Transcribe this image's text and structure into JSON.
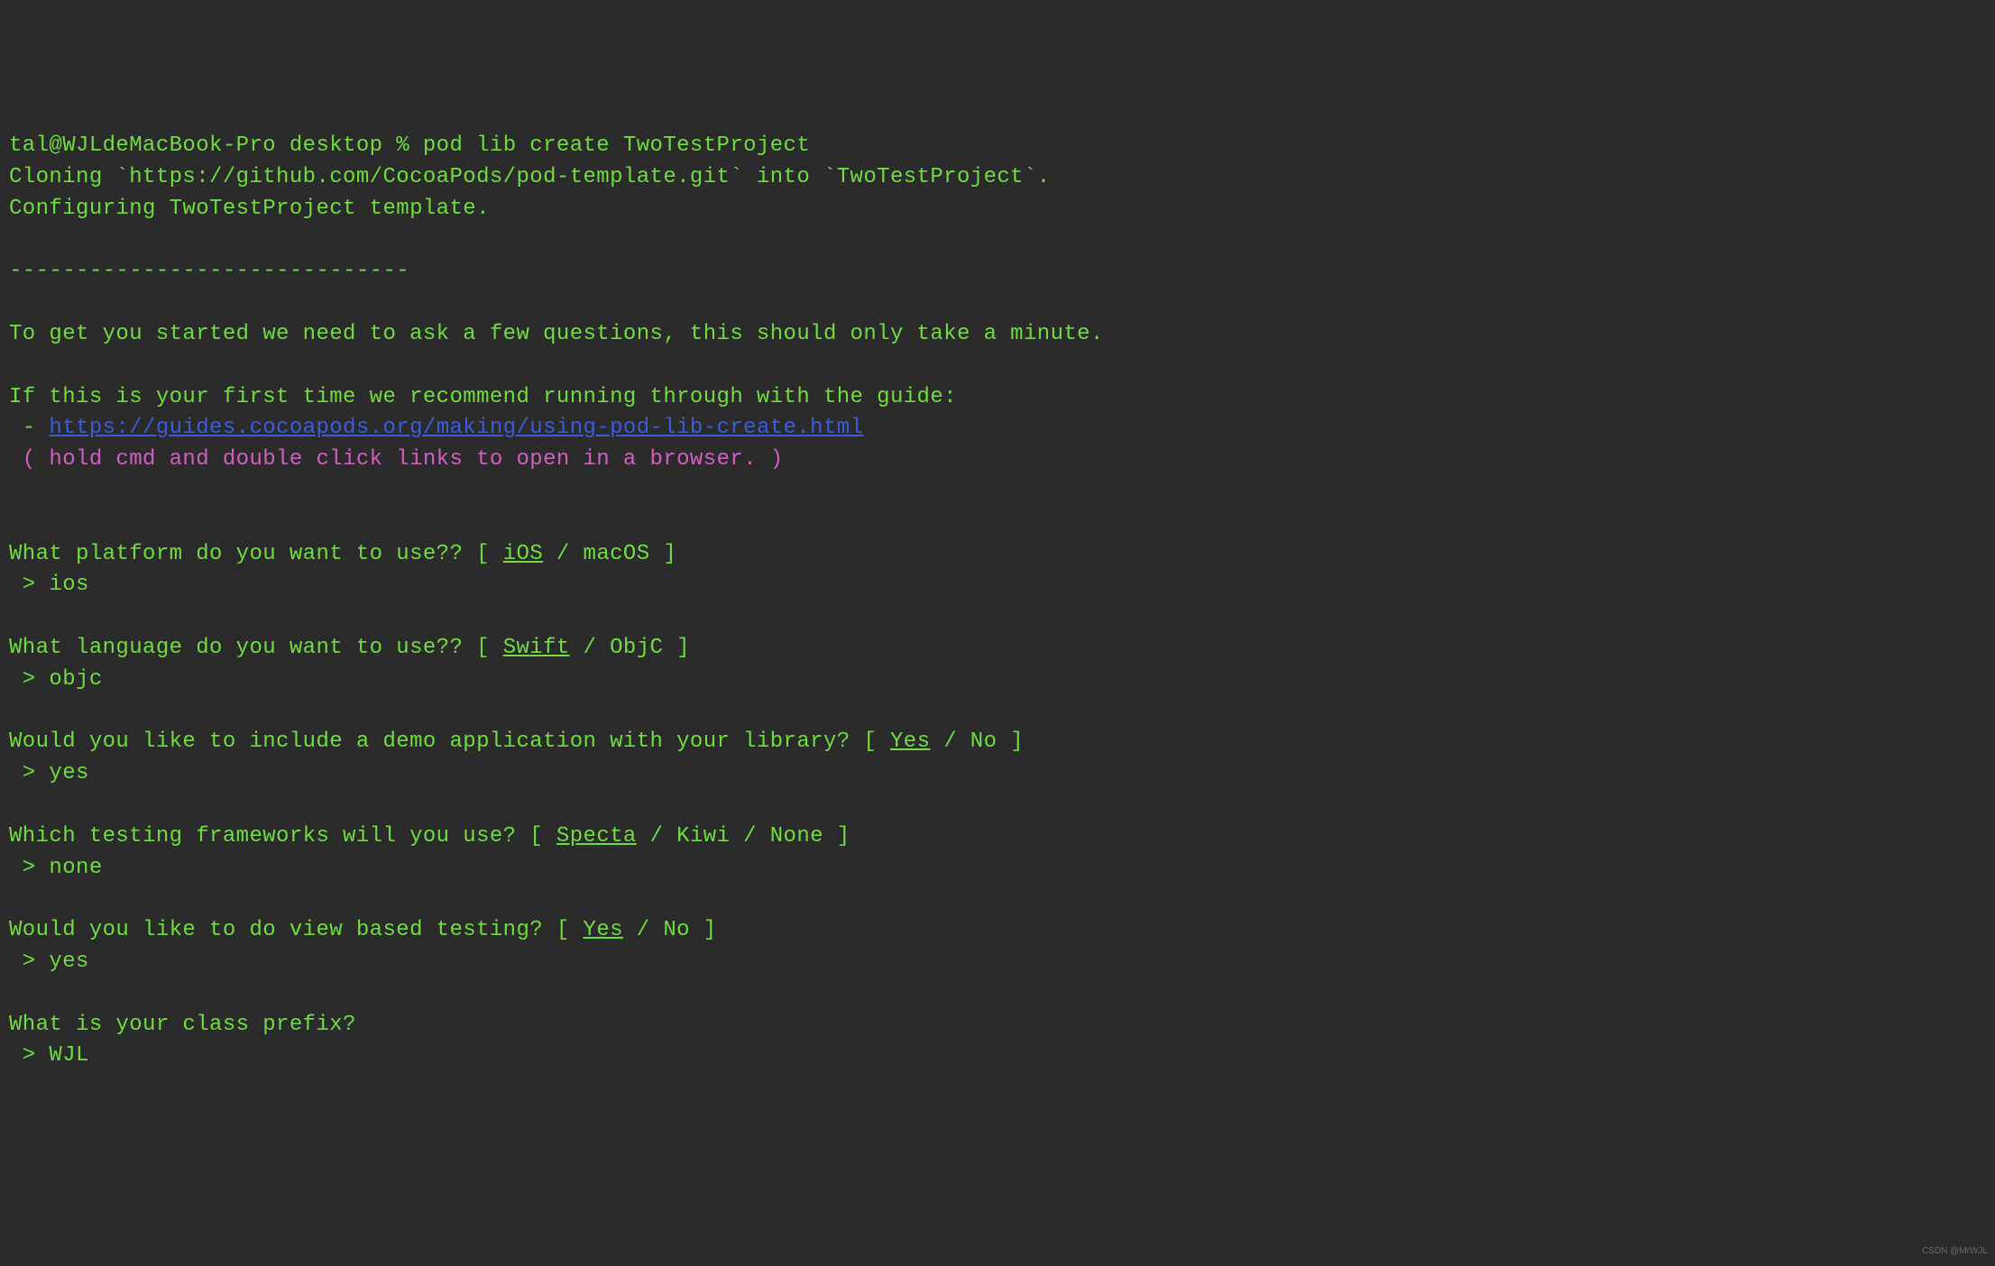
{
  "prompt_user": "tal@WJLdeMacBook-Pro",
  "prompt_dir": " desktop % ",
  "command": "pod lib create TwoTestProject",
  "line_cloning": "Cloning `https://github.com/CocoaPods/pod-template.git` into `TwoTestProject`.",
  "line_configuring": "Configuring TwoTestProject template.",
  "separator": "------------------------------",
  "line_intro1": "To get you started we need to ask a few questions, this should only take a minute.",
  "line_intro2": "If this is your first time we recommend running through with the guide:",
  "guide_bullet": " - ",
  "guide_url": "https://guides.cocoapods.org/making/using-pod-lib-create.html",
  "line_hint": " ( hold cmd and double click links to open in a browser. )",
  "q1_prefix": "What platform do you want to use?? [ ",
  "q1_underlined": "iOS",
  "q1_suffix": " / macOS ]",
  "a1": " > ios",
  "q2_prefix": "What language do you want to use?? [ ",
  "q2_underlined": "Swift",
  "q2_suffix": " / ObjC ]",
  "a2": " > objc",
  "q3_prefix": "Would you like to include a demo application with your library? [ ",
  "q3_underlined": "Yes",
  "q3_suffix": " / No ]",
  "a3": " > yes",
  "q4_prefix": "Which testing frameworks will you use? [ ",
  "q4_underlined": "Specta",
  "q4_suffix": " / Kiwi / None ]",
  "a4": " > none",
  "q5_prefix": "Would you like to do view based testing? [ ",
  "q5_underlined": "Yes",
  "q5_suffix": " / No ]",
  "a5": " > yes",
  "q6": "What is your class prefix?",
  "a6": " > WJL",
  "watermark": "CSDN @MrWJL"
}
